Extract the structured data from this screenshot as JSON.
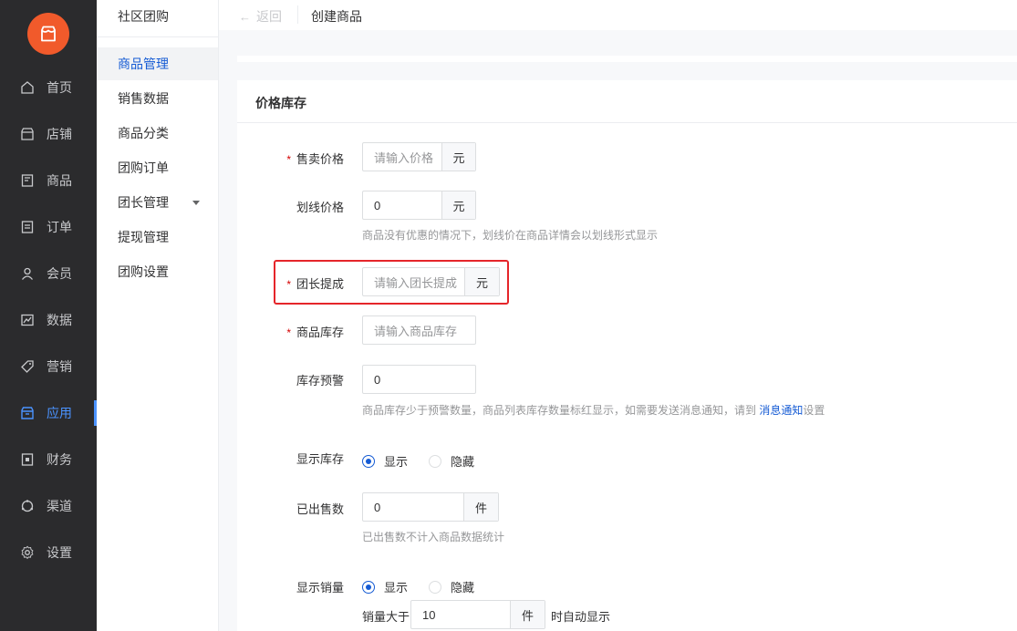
{
  "sidebar": {
    "items": [
      {
        "label": "首页",
        "icon": "home-icon"
      },
      {
        "label": "店铺",
        "icon": "store-icon"
      },
      {
        "label": "商品",
        "icon": "goods-icon"
      },
      {
        "label": "订单",
        "icon": "order-icon"
      },
      {
        "label": "会员",
        "icon": "member-icon"
      },
      {
        "label": "数据",
        "icon": "chart-icon"
      },
      {
        "label": "营销",
        "icon": "tag-icon"
      },
      {
        "label": "应用",
        "icon": "app-icon"
      },
      {
        "label": "财务",
        "icon": "finance-icon"
      },
      {
        "label": "渠道",
        "icon": "channel-icon"
      },
      {
        "label": "设置",
        "icon": "gear-icon"
      }
    ],
    "active_index": 7,
    "accent": "#4b93ff",
    "logo_color": "#f15a2b"
  },
  "subnav": {
    "title": "社区团购",
    "items": [
      "商品管理",
      "销售数据",
      "商品分类",
      "团购订单",
      "团长管理",
      "提现管理",
      "团购设置"
    ],
    "active_index": 0
  },
  "topbar": {
    "back_label": "返回",
    "page_title": "创建商品"
  },
  "section": {
    "title": "价格库存"
  },
  "form": {
    "sale_price": {
      "label": "售卖价格",
      "placeholder": "请输入价格",
      "unit": "元"
    },
    "strike_price": {
      "label": "划线价格",
      "value": "0",
      "unit": "元",
      "hint": "商品没有优惠的情况下，划线价在商品详情会以划线形式显示"
    },
    "leader_commission": {
      "label": "团长提成",
      "placeholder": "请输入团长提成",
      "unit": "元"
    },
    "stock": {
      "label": "商品库存",
      "placeholder": "请输入商品库存"
    },
    "stock_warning": {
      "label": "库存预警",
      "value": "0",
      "hint_prefix": "商品库存少于预警数量，商品列表库存数量标红显示，如需要发送消息通知，请到 ",
      "hint_link": "消息通知",
      "hint_suffix": "设置"
    },
    "show_stock": {
      "label": "显示库存",
      "options": [
        "显示",
        "隐藏"
      ],
      "selected": 0
    },
    "sold_count": {
      "label": "已出售数",
      "value": "0",
      "unit": "件",
      "hint": "已出售数不计入商品数据统计"
    },
    "show_sales": {
      "label": "显示销量",
      "options": [
        "显示",
        "隐藏"
      ],
      "selected": 0
    },
    "sales_threshold": {
      "prefix": "销量大于",
      "value": "10",
      "unit": "件",
      "suffix": "时自动显示"
    }
  },
  "colors": {
    "primary": "#155bd4",
    "required": "#d40000",
    "highlight_border": "#e5252a"
  }
}
